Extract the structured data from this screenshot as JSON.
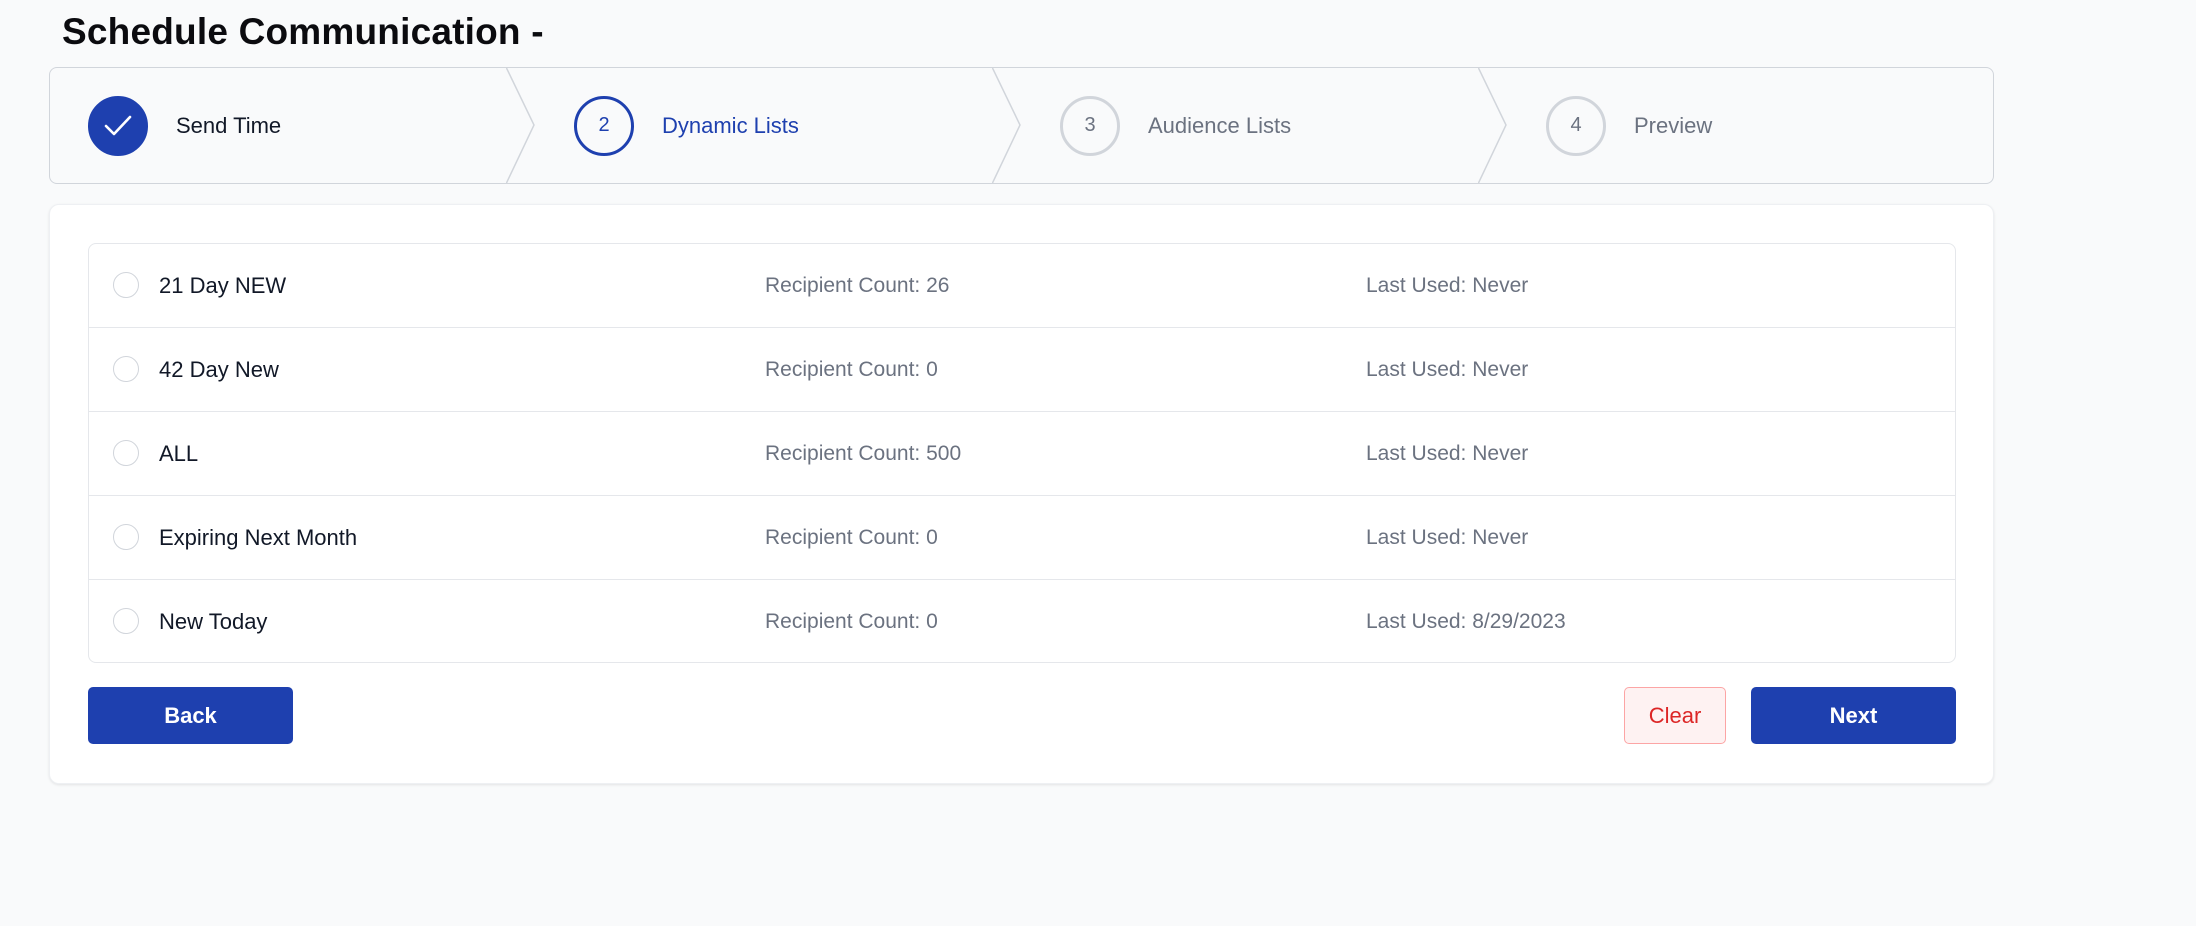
{
  "page": {
    "title": "Schedule Communication -"
  },
  "stepper": {
    "steps": [
      {
        "number": "1",
        "label": "Send Time",
        "state": "completed",
        "icon": "check-icon"
      },
      {
        "number": "2",
        "label": "Dynamic Lists",
        "state": "current"
      },
      {
        "number": "3",
        "label": "Audience Lists",
        "state": "upcoming"
      },
      {
        "number": "4",
        "label": "Preview",
        "state": "upcoming"
      }
    ]
  },
  "lists": [
    {
      "name": "21 Day NEW",
      "recipient_count": "Recipient Count: 26",
      "last_used": "Last Used: Never"
    },
    {
      "name": "42 Day New",
      "recipient_count": "Recipient Count: 0",
      "last_used": "Last Used: Never"
    },
    {
      "name": "ALL",
      "recipient_count": "Recipient Count: 500",
      "last_used": "Last Used: Never"
    },
    {
      "name": "Expiring Next Month",
      "recipient_count": "Recipient Count: 0",
      "last_used": "Last Used: Never"
    },
    {
      "name": "New Today",
      "recipient_count": "Recipient Count: 0",
      "last_used": "Last Used: 8/29/2023"
    }
  ],
  "actions": {
    "back_label": "Back",
    "clear_label": "Clear",
    "next_label": "Next"
  },
  "colors": {
    "primary": "#1e40af",
    "danger": "#dc2626",
    "danger_bg": "#fef2f2",
    "muted_text": "#6b7280",
    "border": "#e5e7eb",
    "page_bg": "#f9fafb"
  }
}
